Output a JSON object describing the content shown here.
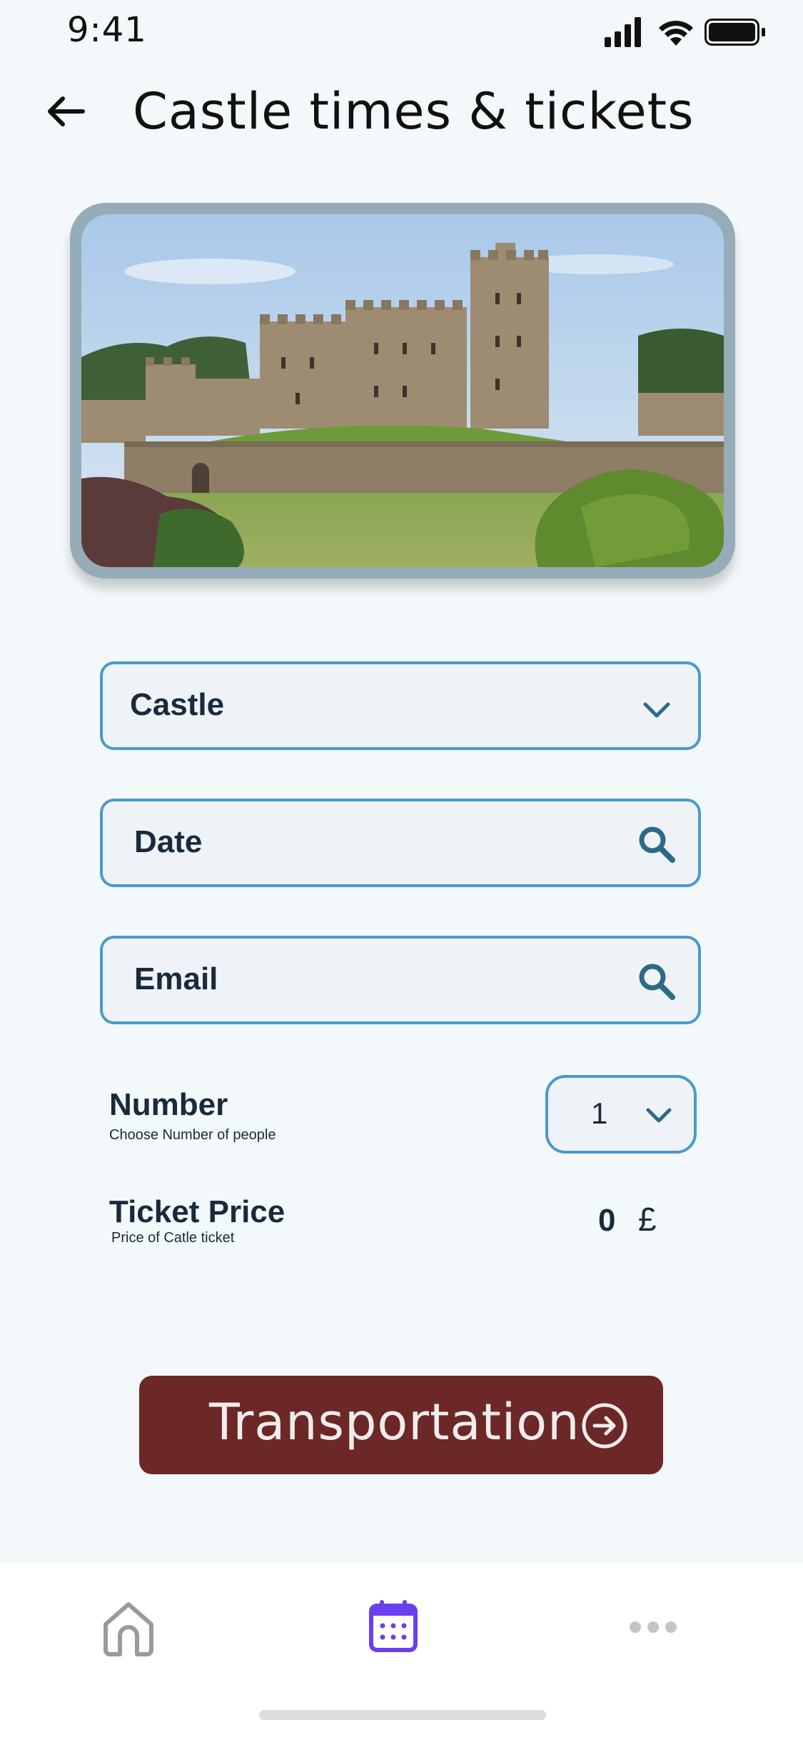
{
  "status_bar": {
    "time": "9:41"
  },
  "header": {
    "title": "Castle times & tickets"
  },
  "form": {
    "castle_select": {
      "value": "Castle"
    },
    "date_field": {
      "label": "Date"
    },
    "email_field": {
      "label": "Email"
    },
    "number": {
      "label": "Number",
      "sublabel": "Choose Number of people",
      "value": "1"
    },
    "ticket_price": {
      "label": "Ticket Price",
      "sublabel": "Price of Catle ticket",
      "value": "0",
      "currency": "£"
    }
  },
  "cta": {
    "label": "Transportation"
  },
  "tabbar": {
    "items": [
      "home-icon",
      "calendar-icon",
      "more-icon"
    ],
    "active": "calendar-icon"
  },
  "colors": {
    "field_border": "#4a99cc",
    "cta_bg": "#6b2826",
    "accent": "#6b3ff0"
  }
}
